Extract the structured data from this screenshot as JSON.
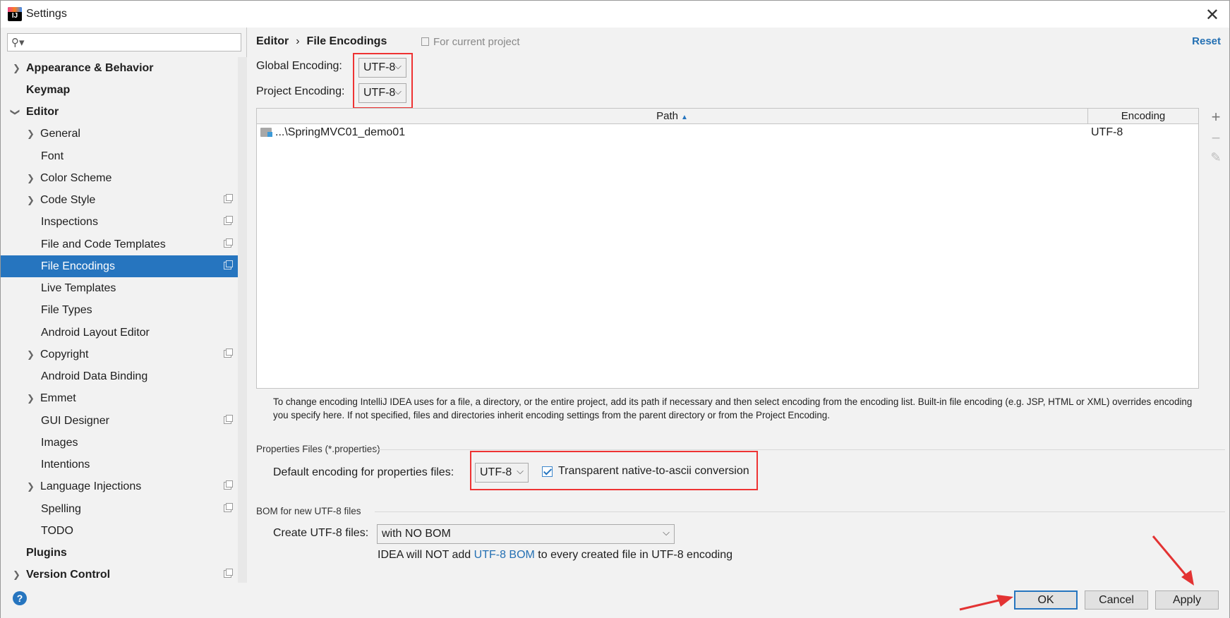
{
  "window": {
    "title": "Settings"
  },
  "search": {
    "placeholder": ""
  },
  "sidebar": {
    "items": [
      {
        "label": "Appearance & Behavior"
      },
      {
        "label": "Keymap"
      },
      {
        "label": "Editor"
      },
      {
        "label": "General"
      },
      {
        "label": "Font"
      },
      {
        "label": "Color Scheme"
      },
      {
        "label": "Code Style"
      },
      {
        "label": "Inspections"
      },
      {
        "label": "File and Code Templates"
      },
      {
        "label": "File Encodings"
      },
      {
        "label": "Live Templates"
      },
      {
        "label": "File Types"
      },
      {
        "label": "Android Layout Editor"
      },
      {
        "label": "Copyright"
      },
      {
        "label": "Android Data Binding"
      },
      {
        "label": "Emmet"
      },
      {
        "label": "GUI Designer"
      },
      {
        "label": "Images"
      },
      {
        "label": "Intentions"
      },
      {
        "label": "Language Injections"
      },
      {
        "label": "Spelling"
      },
      {
        "label": "TODO"
      },
      {
        "label": "Plugins"
      },
      {
        "label": "Version Control"
      }
    ]
  },
  "breadcrumb": {
    "parent": "Editor",
    "separator": "›",
    "current": "File Encodings",
    "scope": "For current project",
    "reset": "Reset"
  },
  "encodings": {
    "global_label": "Global Encoding:",
    "global_value": "UTF-8",
    "project_label": "Project Encoding:",
    "project_value": "UTF-8"
  },
  "table": {
    "col_path": "Path",
    "col_encoding": "Encoding",
    "rows": [
      {
        "path": "...\\SpringMVC01_demo01",
        "encoding": "UTF-8"
      }
    ]
  },
  "tools": {
    "add": "+",
    "remove": "−",
    "edit": "✎"
  },
  "description": "To change encoding IntelliJ IDEA uses for a file, a directory, or the entire project, add its path if necessary and then select encoding from the encoding list. Built-in file encoding (e.g. JSP, HTML or XML) overrides encoding you specify here. If not specified, files and directories inherit encoding settings from the parent directory or from the Project Encoding.",
  "properties": {
    "section": "Properties Files (*.properties)",
    "default_label": "Default encoding for properties files:",
    "default_value": "UTF-8",
    "transparent_label": "Transparent native-to-ascii conversion",
    "transparent_checked": true
  },
  "bom": {
    "section": "BOM for new UTF-8 files",
    "create_label": "Create UTF-8 files:",
    "create_value": "with NO BOM",
    "info_before": "IDEA will NOT add ",
    "info_link": "UTF-8 BOM",
    "info_after": " to every created file in UTF-8 encoding"
  },
  "buttons": {
    "help": "?",
    "ok": "OK",
    "cancel": "Cancel",
    "apply": "Apply"
  },
  "annotations": {
    "highlight_color": "#e33333"
  }
}
